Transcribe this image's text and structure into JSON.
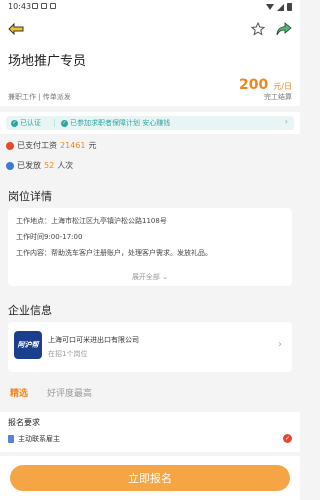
{
  "status_bar": {
    "time": "10:43"
  },
  "job": {
    "title": "场地推广专员",
    "type_text": "兼职工作 | 传单派发",
    "salary_amount": "200",
    "salary_unit": "元/日",
    "settlement": "完工结算"
  },
  "tags": {
    "verified": "已认证",
    "guarantee": "已参加求职者保障计划 安心赚钱"
  },
  "stats": {
    "paid_prefix": "已支付工资",
    "paid_value": "21461",
    "paid_suffix": "元",
    "issued_prefix": "已发放",
    "issued_value": "52",
    "issued_suffix": "人次"
  },
  "detail": {
    "section_title": "岗位详情",
    "location": "工作地点：上海市松江区九亭镇沪松公路1108号",
    "time": "工作时间9:00-17:00",
    "content": "工作内容：帮助洗车客户注册账户，处理客户需求。发放礼品。",
    "expand_label": "展开全部"
  },
  "company": {
    "section_title": "企业信息",
    "logo_text": "阿沪帮",
    "name": "上海可口可米进出口有限公司",
    "sub": "在招1个岗位"
  },
  "tabs": {
    "active": "精选",
    "inactive": "好评度最高"
  },
  "requirements": {
    "title": "报名要求",
    "item": "主动联系雇主"
  },
  "apply_label": "立即报名",
  "colors": {
    "accent": "#f0861f",
    "teal": "#2aa7a0",
    "button": "#f6a545"
  }
}
